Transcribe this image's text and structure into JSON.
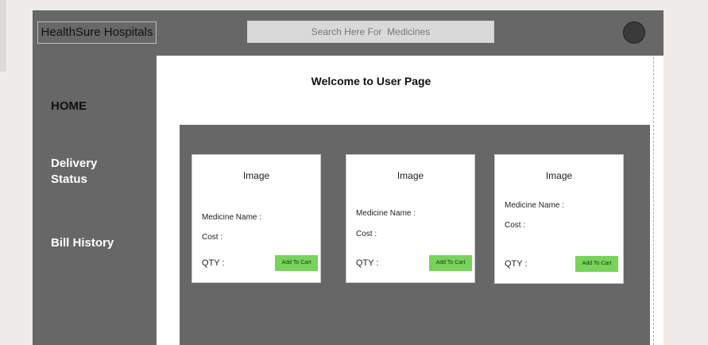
{
  "header": {
    "brand": "HealthSure Hospitals",
    "search_placeholder": "Search Here For  Medicines"
  },
  "sidebar": {
    "items": [
      {
        "label": "HOME"
      },
      {
        "label": "Delivery Status"
      },
      {
        "label": "Bill History"
      }
    ]
  },
  "main": {
    "welcome": "Welcome to User Page",
    "cards": [
      {
        "image_label": "Image",
        "name_label": "Medicine Name :",
        "cost_label": "Cost :",
        "qty_label": "QTY :",
        "button_label": "Add To Cart"
      },
      {
        "image_label": "Image",
        "name_label": "Medicine Name :",
        "cost_label": "Cost :",
        "qty_label": "QTY :",
        "button_label": "Add To Cart"
      },
      {
        "image_label": "Image",
        "name_label": "Medicine Name :",
        "cost_label": "Cost :",
        "qty_label": "QTY :",
        "button_label": "Add To Cart"
      }
    ]
  },
  "colors": {
    "header_bg": "#676767",
    "cart_button": "#78d35a",
    "avatar": "#3a3a3a"
  }
}
